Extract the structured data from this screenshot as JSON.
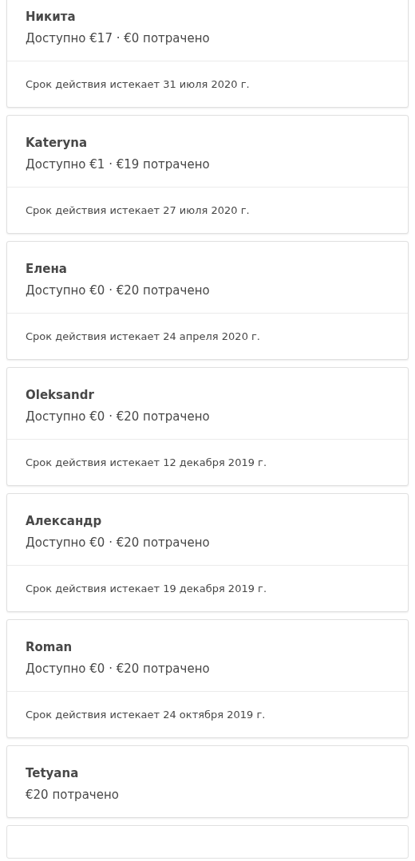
{
  "credits": [
    {
      "name": "Никита",
      "balance": "Доступно €17 · €0 потрачено",
      "expiry": "Срок действия истекает 31 июля 2020 г."
    },
    {
      "name": "Kateryna",
      "balance": "Доступно €1 · €19 потрачено",
      "expiry": "Срок действия истекает 27 июля 2020 г."
    },
    {
      "name": "Елена",
      "balance": "Доступно €0 · €20 потрачено",
      "expiry": "Срок действия истекает 24 апреля 2020 г."
    },
    {
      "name": "Oleksandr",
      "balance": "Доступно €0 · €20 потрачено",
      "expiry": "Срок действия истекает 12 декабря 2019 г."
    },
    {
      "name": "Александр",
      "balance": "Доступно €0 · €20 потрачено",
      "expiry": "Срок действия истекает 19 декабря 2019 г."
    },
    {
      "name": "Roman",
      "balance": "Доступно €0 · €20 потрачено",
      "expiry": "Срок действия истекает 24 октября 2019 г."
    },
    {
      "name": "Tetyana",
      "balance": "€20 потрачено"
    }
  ]
}
